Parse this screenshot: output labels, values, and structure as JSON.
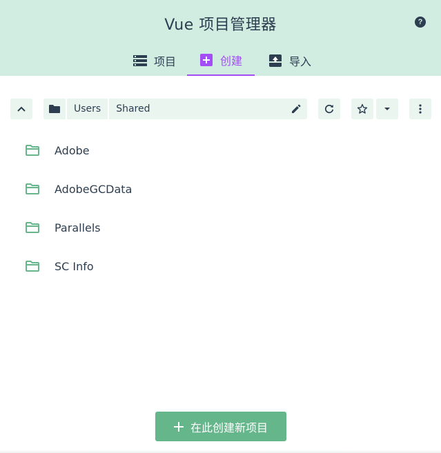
{
  "header": {
    "title": "Vue 项目管理器",
    "help_label": "?"
  },
  "tabs": [
    {
      "label": "项目",
      "icon": "list-icon",
      "active": false
    },
    {
      "label": "创建",
      "icon": "add-box-icon",
      "active": true
    },
    {
      "label": "导入",
      "icon": "unarchive-icon",
      "active": false
    }
  ],
  "toolbar": {
    "path": [
      "Users",
      "Shared"
    ]
  },
  "folders": [
    {
      "name": "Adobe"
    },
    {
      "name": "AdobeGCData"
    },
    {
      "name": "Parallels"
    },
    {
      "name": "SC Info"
    }
  ],
  "create_button": {
    "label": "在此创建新项目"
  },
  "colors": {
    "header_bg": "#d1ece0",
    "accent": "#a44cf6",
    "primary": "#66b68c",
    "text": "#2c3e50",
    "toolbar_bg": "#eaf5ef"
  }
}
